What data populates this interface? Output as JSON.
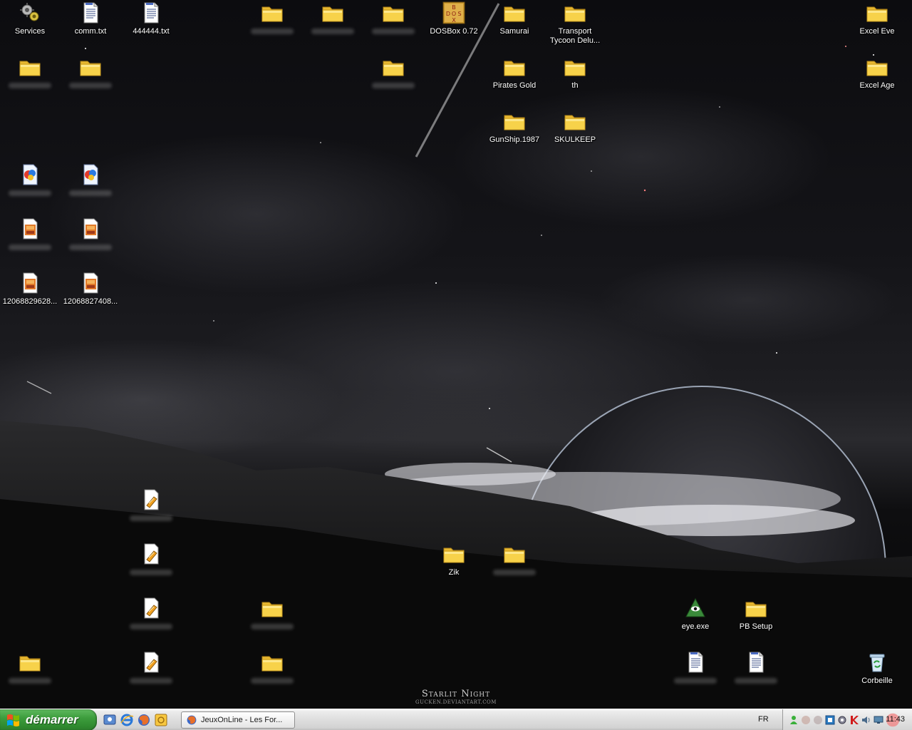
{
  "desktop": {
    "icons": {
      "services": "Services",
      "comm": "comm.txt",
      "file444444": "444444.txt",
      "dosbox": "DOSBox 0.72",
      "samurai": "Samurai",
      "transport": "Transport Tycoon Delu...",
      "excel_eve": "Excel Eve",
      "pirates": "Pirates Gold",
      "th": "th",
      "excel_age": "Excel Age",
      "gunship": "GunShip.1987",
      "skulkeep": "SKULKEEP",
      "img1": "12068829628...",
      "img2": "12068827408...",
      "zik": "Zik",
      "eye": "eye.exe",
      "pbsetup": "PB Setup",
      "recycle": "Corbeille"
    },
    "dosbox_icon_letters": [
      "B",
      "D",
      "O",
      "S",
      "X"
    ]
  },
  "wallpaper": {
    "title": "Starlit Night",
    "credit": "GUCKEN.DEVIANTART.COM"
  },
  "taskbar": {
    "start_label": "démarrer",
    "task_title": "JeuxOnLine - Les For...",
    "language": "FR",
    "clock": "11:43"
  },
  "colors": {
    "folder": "#f7d24a",
    "start_green": "#3d9d3d"
  }
}
